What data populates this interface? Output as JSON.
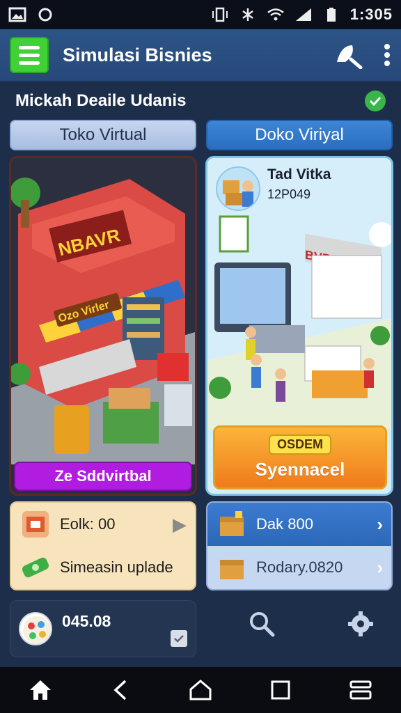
{
  "status_bar": {
    "time": "1:305"
  },
  "app_bar": {
    "title": "Simulasi Bisnies"
  },
  "subtitle": "Mickah Deaile Udanis",
  "tabs": [
    {
      "label": "Toko Virtual"
    },
    {
      "label": "Doko Viriyal"
    }
  ],
  "left_card": {
    "shop_sign": "NBAVR",
    "awning_sign": "Ozo Virler",
    "cta_label": "Ze Sddvirtbal"
  },
  "right_card": {
    "name": "Tad Vitka",
    "number": "12P049",
    "shop_sign": "BVRGIA",
    "badge": "OSDEM",
    "cta_label": "Syennacel"
  },
  "panel_left": {
    "row1": "Eolk: 00",
    "row2": "Simeasin uplade"
  },
  "panel_right": {
    "row1": "Dak 800",
    "row2": "Rodary.0820"
  },
  "profile": {
    "value": "045.08"
  },
  "colors": {
    "menu_green": "#3fd136",
    "appbar_blue": "#2d5487",
    "tab_active": "#3d85d6",
    "left_cta_purple": "#b11de0",
    "right_cta_orange": "#f07a1c"
  }
}
